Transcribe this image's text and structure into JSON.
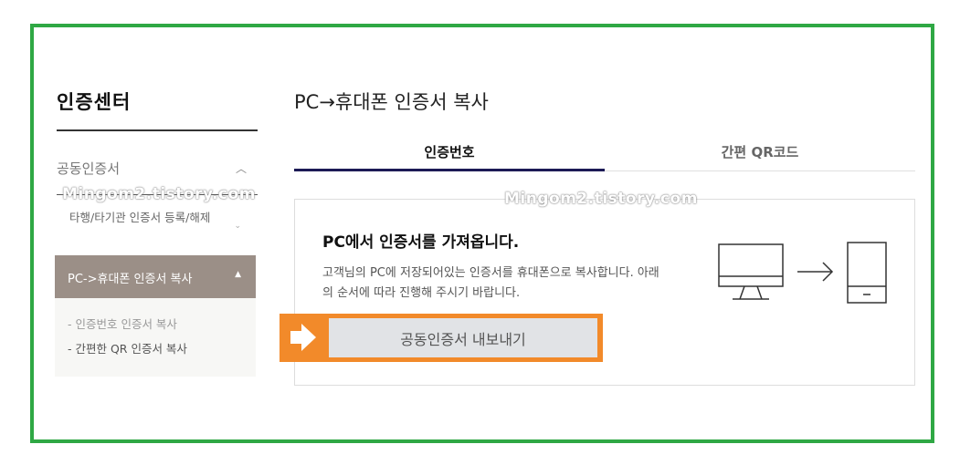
{
  "sidebar": {
    "title": "인증센터",
    "section_label": "공동인증서",
    "section_chevron_icon": "chevron-up-icon",
    "items": [
      {
        "label": "타행/타기관 인증서 등록/해제",
        "state": "collapsed"
      },
      {
        "label": "PC->휴대폰 인증서 복사",
        "state": "active"
      }
    ],
    "subitems": [
      {
        "label": "- 인증번호 인증서 복사"
      },
      {
        "label": "- 간편한 QR 인증서 복사"
      }
    ]
  },
  "main": {
    "title": "PC→휴대폰 인증서 복사",
    "tabs": [
      {
        "label": "인증번호",
        "active": true
      },
      {
        "label": "간편 QR코드",
        "active": false
      }
    ],
    "panel": {
      "heading": "PC에서 인증서를 가져옵니다.",
      "description": "고객님의 PC에 저장되어있는 인증서를 휴대폰으로 복사합니다. 아래의 순서에 따라 진행해 주시기 바랍니다.",
      "export_button": "공동인증서 내보내기"
    },
    "illustration_icons": [
      "monitor-icon",
      "arrow-right-icon",
      "phone-icon"
    ]
  },
  "watermark": "Mingom2.tistory.com",
  "colors": {
    "frame": "#2fa844",
    "active_sidebar": "#9b8f87",
    "tab_underline": "#1c1a55",
    "highlight": "#f28a2a",
    "button_bg": "#e1e3e6"
  }
}
